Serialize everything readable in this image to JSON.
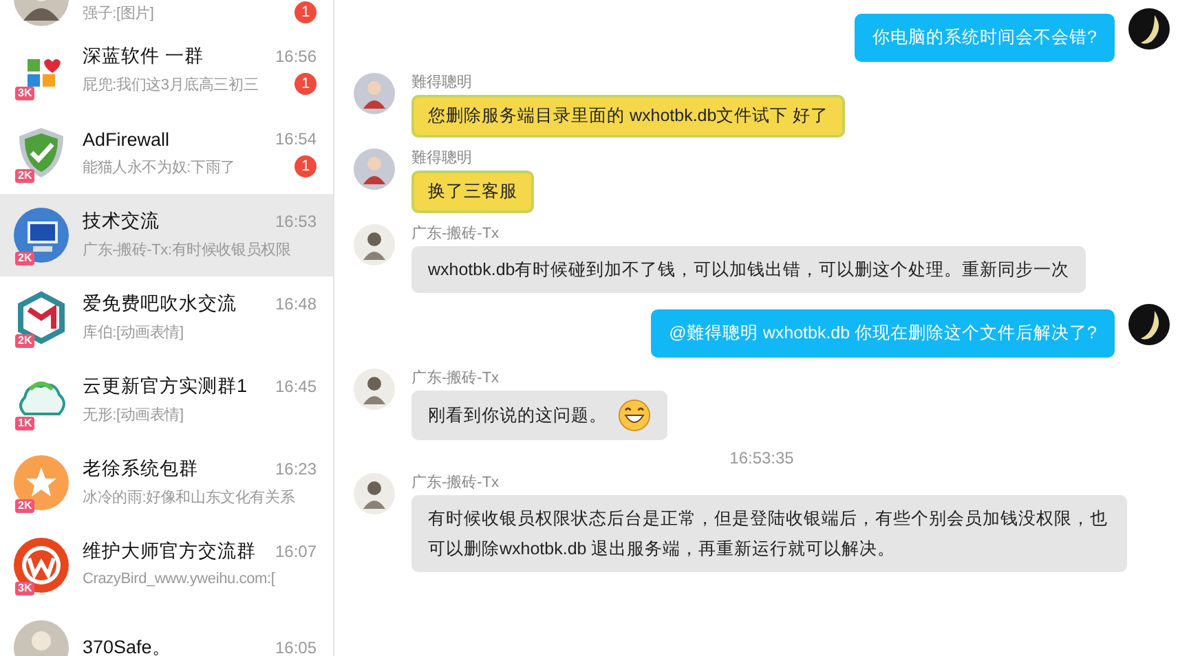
{
  "conversations": [
    {
      "kind": "photo",
      "preview": "强子:[图片]",
      "unread": "1",
      "selected": false
    },
    {
      "kind": "grid",
      "name": "深蓝软件 一群",
      "preview": "屁兜:我们这3月底高三初三",
      "time": "16:56",
      "level_badge": "3K",
      "unread": "1",
      "selected": false
    },
    {
      "kind": "shield",
      "name": "AdFirewall",
      "preview": "能猫人永不为奴:下雨了",
      "time": "16:54",
      "level_badge": "2K",
      "unread": "1",
      "selected": false
    },
    {
      "kind": "monitor",
      "name": "技术交流",
      "preview": "广东-搬砖-Tx:有时候收银员权限",
      "time": "16:53",
      "level_badge": "2K",
      "selected": true
    },
    {
      "kind": "mf",
      "name": "爱免费吧吹水交流",
      "preview": "库伯:[动画表情]",
      "time": "16:48",
      "level_badge": "2K",
      "selected": false
    },
    {
      "kind": "cloud",
      "name": "云更新官方实测群1",
      "preview": "无形:[动画表情]",
      "time": "16:45",
      "level_badge": "1K",
      "selected": false
    },
    {
      "kind": "star",
      "name": "老徐系统包群",
      "preview": "冰冷的雨:好像和山东文化有关系",
      "time": "16:23",
      "level_badge": "2K",
      "selected": false
    },
    {
      "kind": "wlogo",
      "name": "维护大师官方交流群",
      "preview": "CrazyBird_www.yweihu.com:[",
      "time": "16:07",
      "level_badge": "3K",
      "selected": false
    },
    {
      "kind": "photo",
      "name": "370Safe。",
      "time": "16:05",
      "selected": false
    }
  ],
  "messages": [
    {
      "kind": "self",
      "text": "你电脑的系统时间会不会错?"
    },
    {
      "kind": "yellow",
      "sender": "難得聰明",
      "text": "您删除服务端目录里面的 wxhotbk.db文件试下  好了"
    },
    {
      "kind": "yellow",
      "sender": "難得聰明",
      "text": "换了三客服"
    },
    {
      "kind": "other",
      "sender": "广东-搬砖-Tx",
      "text": "wxhotbk.db有时候碰到加不了钱，可以加钱出错，可以删这个处理。重新同步一次"
    },
    {
      "kind": "self",
      "text": "@難得聰明  wxhotbk.db  你现在删除这个文件后解决了?"
    },
    {
      "kind": "other",
      "sender": "广东-搬砖-Tx",
      "text": "刚看到你说的这问题。",
      "emoji": true
    },
    {
      "kind": "time",
      "text": "16:53:35"
    },
    {
      "kind": "other",
      "sender": "广东-搬砖-Tx",
      "text": "有时候收银员权限状态后台是正常，但是登陆收银端后，有些个别会员加钱没权限，也可以删除wxhotbk.db 退出服务端，再重新运行就可以解决。"
    }
  ]
}
